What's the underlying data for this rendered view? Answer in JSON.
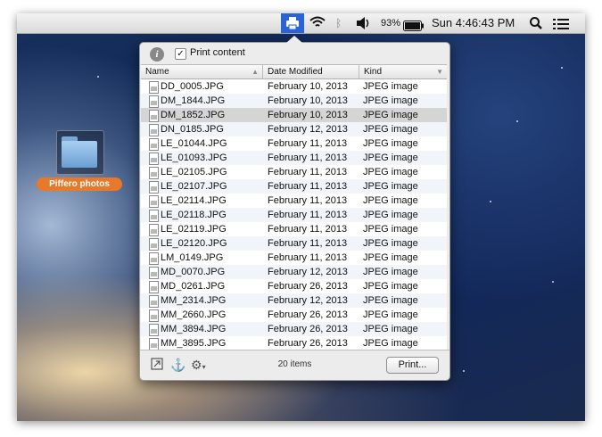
{
  "menubar": {
    "printer_icon": "printer-icon",
    "wifi_icon": "wifi-icon",
    "bluetooth_icon": "bluetooth-icon",
    "volume_icon": "volume-icon",
    "battery_percent": "93%",
    "battery_icon": "battery-icon",
    "clock": "Sun 4:46:43 PM",
    "search_icon": "search-icon",
    "list_icon": "notification-list-icon"
  },
  "popover": {
    "info_icon": "info-icon",
    "print_content_label": "Print content",
    "print_content_checked": true,
    "columns": {
      "name": "Name",
      "date": "Date Modified",
      "kind": "Kind"
    },
    "rows": [
      {
        "name": "DD_0005.JPG",
        "date": "February 10, 2013",
        "kind": "JPEG image"
      },
      {
        "name": "DM_1844.JPG",
        "date": "February 10, 2013",
        "kind": "JPEG image"
      },
      {
        "name": "DM_1852.JPG",
        "date": "February 10, 2013",
        "kind": "JPEG image",
        "selected": true
      },
      {
        "name": "DN_0185.JPG",
        "date": "February 12, 2013",
        "kind": "JPEG image"
      },
      {
        "name": "LE_01044.JPG",
        "date": "February 11, 2013",
        "kind": "JPEG image"
      },
      {
        "name": "LE_01093.JPG",
        "date": "February 11, 2013",
        "kind": "JPEG image"
      },
      {
        "name": "LE_02105.JPG",
        "date": "February 11, 2013",
        "kind": "JPEG image"
      },
      {
        "name": "LE_02107.JPG",
        "date": "February 11, 2013",
        "kind": "JPEG image"
      },
      {
        "name": "LE_02114.JPG",
        "date": "February 11, 2013",
        "kind": "JPEG image"
      },
      {
        "name": "LE_02118.JPG",
        "date": "February 11, 2013",
        "kind": "JPEG image"
      },
      {
        "name": "LE_02119.JPG",
        "date": "February 11, 2013",
        "kind": "JPEG image"
      },
      {
        "name": "LE_02120.JPG",
        "date": "February 11, 2013",
        "kind": "JPEG image"
      },
      {
        "name": "LM_0149.JPG",
        "date": "February 11, 2013",
        "kind": "JPEG image"
      },
      {
        "name": "MD_0070.JPG",
        "date": "February 12, 2013",
        "kind": "JPEG image"
      },
      {
        "name": "MD_0261.JPG",
        "date": "February 26, 2013",
        "kind": "JPEG image"
      },
      {
        "name": "MM_2314.JPG",
        "date": "February 12, 2013",
        "kind": "JPEG image"
      },
      {
        "name": "MM_2660.JPG",
        "date": "February 26, 2013",
        "kind": "JPEG image"
      },
      {
        "name": "MM_3894.JPG",
        "date": "February 26, 2013",
        "kind": "JPEG image"
      },
      {
        "name": "MM_3895.JPG",
        "date": "February 26, 2013",
        "kind": "JPEG image"
      }
    ],
    "footer": {
      "expand_icon": "resize-icon",
      "anchor_icon": "anchor-icon",
      "gear_icon": "gear-icon",
      "item_count": "20 items",
      "print_button": "Print..."
    }
  },
  "desktop": {
    "folder_icon": "folder-icon",
    "folder_label": "Piffero photos"
  }
}
